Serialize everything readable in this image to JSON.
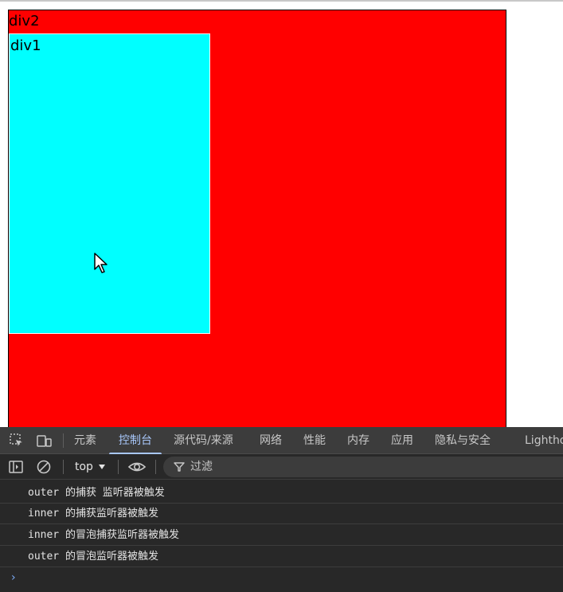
{
  "page": {
    "div2_label": "div2",
    "div1_label": "div1"
  },
  "devtools": {
    "tabs": [
      {
        "label": "元素"
      },
      {
        "label": "控制台"
      },
      {
        "label": "源代码/来源"
      },
      {
        "label": "网络"
      },
      {
        "label": "性能"
      },
      {
        "label": "内存"
      },
      {
        "label": "应用"
      },
      {
        "label": "隐私与安全"
      },
      {
        "label": "Lighthouse"
      }
    ],
    "active_tab": "控制台",
    "context": "top",
    "filter_label": "过滤",
    "logs": [
      "outer 的捕获 监听器被触发",
      "inner 的捕获监听器被触发",
      "inner 的冒泡捕获监听器被触发",
      "outer 的冒泡监听器被触发"
    ],
    "prompt": "›"
  },
  "colors": {
    "div2_bg": "#ff0000",
    "div1_bg": "#00ffff",
    "devtools_bg": "#282828",
    "active_tab": "#a8c7fa"
  },
  "icons": [
    "inspect-element-icon",
    "device-toolbar-icon",
    "sidebar-toggle-icon",
    "clear-console-icon",
    "eye-icon",
    "filter-icon",
    "cursor-icon"
  ]
}
